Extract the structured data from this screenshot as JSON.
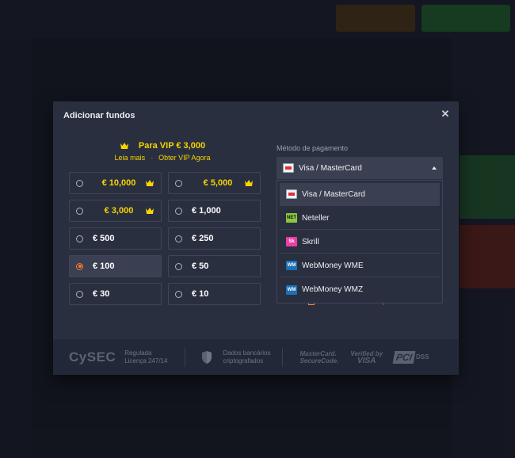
{
  "modal": {
    "title": "Adicionar fundos",
    "close_icon": "close-icon"
  },
  "vip": {
    "line": "Para VIP  € 3,000",
    "read_more": "Leia mais",
    "separator": "-",
    "get_vip": "Obter VIP Agora",
    "crown_icon": "crown-icon"
  },
  "amounts": [
    {
      "label": "€ 10,000",
      "vip": true,
      "selected": false
    },
    {
      "label": "€ 5,000",
      "vip": true,
      "selected": false
    },
    {
      "label": "€ 3,000",
      "vip": true,
      "selected": false
    },
    {
      "label": "€ 1,000",
      "vip": false,
      "selected": false
    },
    {
      "label": "€ 500",
      "vip": false,
      "selected": false
    },
    {
      "label": "€ 250",
      "vip": false,
      "selected": false
    },
    {
      "label": "€ 100",
      "vip": false,
      "selected": true
    },
    {
      "label": "€ 50",
      "vip": false,
      "selected": false
    },
    {
      "label": "€ 30",
      "vip": false,
      "selected": false
    },
    {
      "label": "€ 10",
      "vip": false,
      "selected": false
    }
  ],
  "payment": {
    "label": "Método de pagamento",
    "selected": "Visa / MasterCard",
    "options": [
      {
        "label": "Visa / MasterCard",
        "icon": "visa-mastercard-icon"
      },
      {
        "label": "Neteller",
        "icon": "neteller-icon",
        "badge": "NET"
      },
      {
        "label": "Skrill",
        "icon": "skrill-icon",
        "badge": "Sk"
      },
      {
        "label": "WebMoney WME",
        "icon": "webmoney-icon",
        "badge": "WM"
      },
      {
        "label": "WebMoney WMZ",
        "icon": "webmoney-icon",
        "badge": "WM"
      }
    ]
  },
  "terms": {
    "prefix": "Aceito",
    "link": "Termos e condições"
  },
  "footer": {
    "cysec": "CySEC",
    "regulated_line1": "Regulada",
    "regulated_line2": "Licença 247/14",
    "data_line1": "Dados bancários",
    "data_line2": "criptografados",
    "mastercard_line1": "MasterCard.",
    "mastercard_line2": "SecureCode.",
    "verified_line1": "Verified by",
    "verified_line2": "VISA",
    "pci": "PCI",
    "dss": "DSS"
  },
  "colors": {
    "vip_yellow": "#f5d400",
    "accent_orange": "#ff7a2a",
    "modal_bg": "#2a2f3f"
  }
}
